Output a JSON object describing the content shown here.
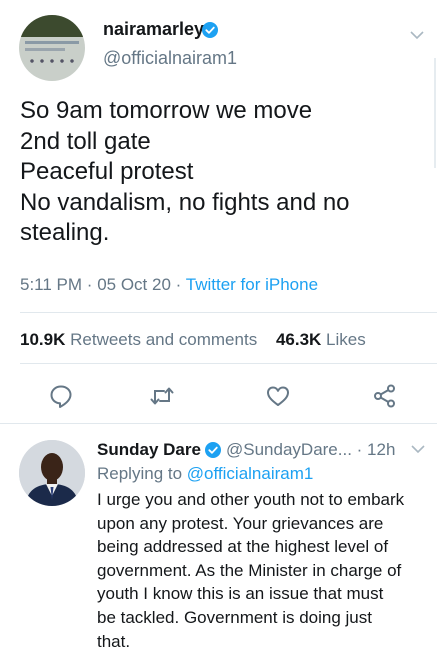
{
  "main_tweet": {
    "display_name": "nairamarley",
    "handle": "@officialnairam1",
    "text_lines": [
      "So 9am tomorrow we move",
      "2nd toll gate",
      "Peaceful protest",
      "No vandalism, no fights and no",
      "stealing."
    ],
    "time": "5:11 PM",
    "date": "05 Oct 20",
    "separator": "·",
    "source": "Twitter for iPhone",
    "retweets_count": "10.9K",
    "retweets_label": "Retweets and comments",
    "likes_count": "46.3K",
    "likes_label": "Likes",
    "actions": [
      "reply-icon",
      "retweet-icon",
      "like-icon",
      "share-icon"
    ]
  },
  "reply_tweet": {
    "display_name": "Sunday Dare",
    "handle_time": "@SundayDare... · 12h",
    "replying_to_label": "Replying to",
    "replying_to_handle": "@officialnairam1",
    "text_lines": [
      "I urge you and other youth not to embark",
      "upon any protest. Your  grievances are",
      "being addressed at the highest level of",
      "government. As the Minister in charge of",
      "youth I know this is an issue that must",
      "be tackled. Government is doing just",
      "that."
    ]
  },
  "colors": {
    "link_blue": "#1da1f2",
    "secondary_text": "#657786",
    "primary_text": "#14171a",
    "divider": "#e1e8ed"
  }
}
